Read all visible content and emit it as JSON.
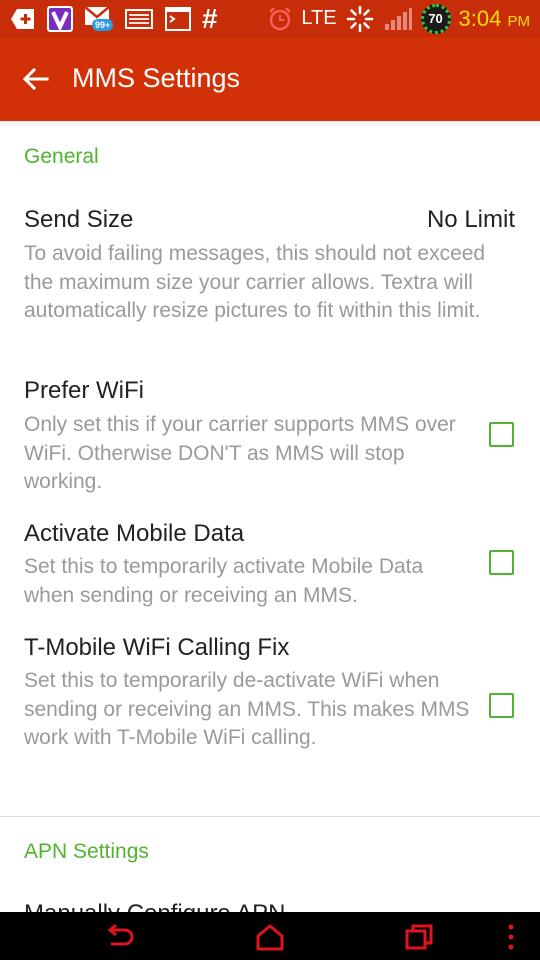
{
  "status_bar": {
    "network": "LTE",
    "battery_level": "70",
    "time": "3:04",
    "ampm": "PM",
    "notification_badge": "99+",
    "hash_symbol": "#",
    "icons": [
      "add-icon",
      "viber-icon",
      "gmail-icon",
      "email-icon",
      "terminal-icon",
      "hash-icon",
      "alarm-icon",
      "data-sync-icon",
      "signal-icon",
      "battery-icon"
    ]
  },
  "app_bar": {
    "title": "MMS Settings",
    "back_icon": "arrow-left-icon"
  },
  "sections": {
    "general": {
      "header": "General",
      "send_size": {
        "title": "Send Size",
        "value": "No Limit",
        "summary": "To avoid failing messages, this should not exceed the maximum size your carrier allows. Textra will automatically resize pictures to fit within this limit."
      },
      "prefer_wifi": {
        "title": "Prefer WiFi",
        "summary": "Only set this if your carrier supports MMS over WiFi. Otherwise DON'T as MMS will stop working.",
        "checked": false
      },
      "activate_mobile_data": {
        "title": "Activate Mobile Data",
        "summary": "Set this to temporarily activate Mobile Data when sending or receiving an MMS.",
        "checked": false
      },
      "tmobile_wifi_fix": {
        "title": "T-Mobile WiFi Calling Fix",
        "summary": "Set this to temporarily de-activate WiFi when sending or receiving an MMS. This makes MMS work with T-Mobile WiFi calling.",
        "checked": false
      }
    },
    "apn": {
      "header": "APN Settings",
      "manual_configure": {
        "title": "Manually Configure APN"
      }
    }
  },
  "nav_bar": {
    "icons": [
      "back-icon",
      "home-icon",
      "recent-apps-icon",
      "menu-icon"
    ]
  },
  "colors": {
    "status_bar": "#c62d08",
    "app_bar": "#d23107",
    "accent_green": "#52b330",
    "nav_icons": "#e0141e"
  }
}
